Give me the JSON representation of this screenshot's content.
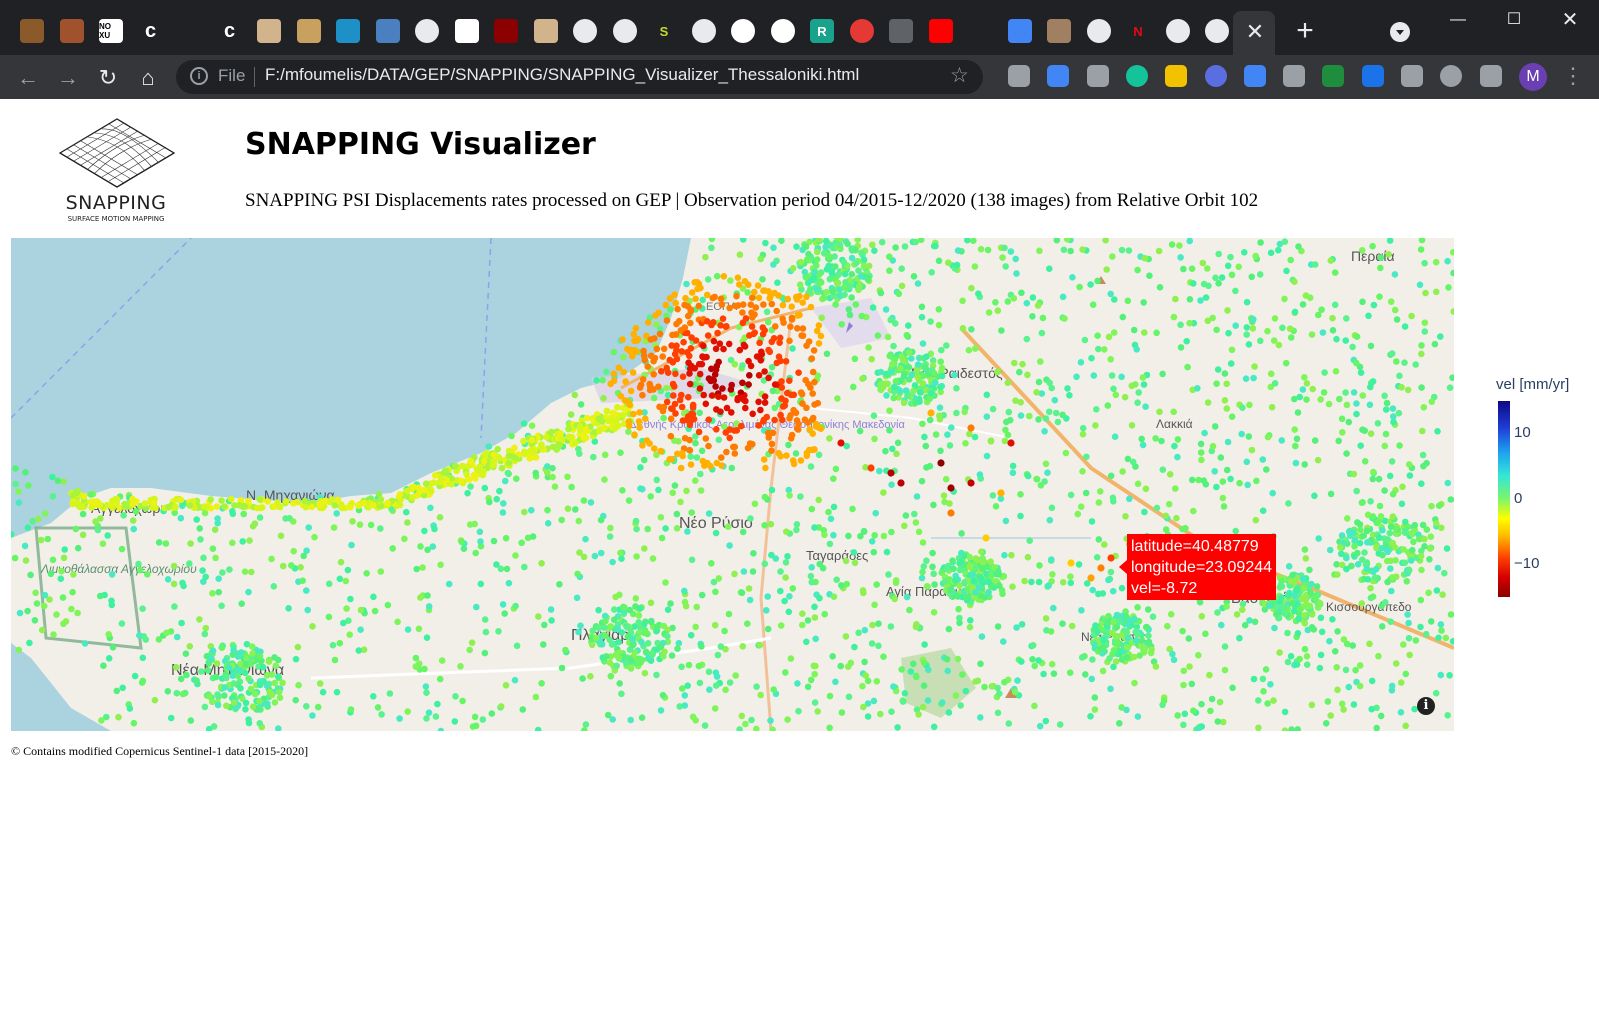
{
  "browser": {
    "tab_favicons": [
      "app-icon",
      "app-icon",
      "noxu-icon",
      "c-icon",
      "blank-icon",
      "c-icon",
      "app-icon",
      "app-icon",
      "sdesi-icon",
      "app-icon",
      "globe-icon",
      "app-icon",
      "app-icon",
      "app-icon",
      "globe-icon",
      "globe-icon",
      "s-icon",
      "chrome-icon",
      "google-icon",
      "google-icon",
      "r-icon",
      "record-icon",
      "app-icon",
      "youtube-icon",
      "link-icon",
      "translate-icon",
      "image-icon",
      "chrome-icon",
      "netflix-icon",
      "chrome-icon",
      "chrome-icon"
    ],
    "tab_letters": {
      "noxu": "NO XU",
      "c": "c",
      "s": "S",
      "r": "R",
      "netflix": "N"
    },
    "address_scheme": "File",
    "address_url": "F:/mfoumelis/DATA/GEP/SNAPPING/SNAPPING_Visualizer_Thessaloniki.html",
    "profile_initial": "M",
    "accent": "#35363a"
  },
  "page": {
    "logo_name": "SNAPPING",
    "logo_tagline": "SURFACE MOTION MAPPING",
    "title": "SNAPPING Visualizer",
    "subtitle": "SNAPPING PSI Displacements rates processed on GEP | Observation period 04/2015-12/2020 (138 images) from Relative Orbit 102",
    "copyright": "© Contains modified Copernicus Sentinel-1 data [2015-2020]"
  },
  "map": {
    "place_labels": [
      "Περαία",
      "Ν. Μηχανιώνα",
      "Αγγελοχώρι",
      "Λιμνοθάλασσα Αγγελοχωρίου",
      "Νέα Μηχανιώνα",
      "Νέα Ραιδεστός",
      "Πλαγιάρι",
      "Νέο Ρύσιο",
      "Ταγαράδες",
      "Αγία Παρασκευή",
      "Βασιλικά",
      "Κισσουργάπεδο",
      "Λακκιά",
      "Νέα Ρασσός",
      "Διεθνής Κρατικός Αερολιμένας Θεσσαλονίκης Μακεδονία",
      "ΕΟΠΑ"
    ],
    "tooltip": {
      "latitude": "latitude=40.48779",
      "longitude": "longitude=23.09244",
      "velocity": "vel=-8.72"
    },
    "colorbar": {
      "title": "vel [mm/yr]",
      "ticks": [
        "10",
        "0",
        "−10"
      ],
      "colorscale": [
        "#0d0887",
        "#1ea0f0",
        "#33e6d8",
        "#7cf56a",
        "#ffff00",
        "#ffb000",
        "#ff4000",
        "#d40000",
        "#8b0000"
      ]
    },
    "colors": {
      "sea": "#aad3df",
      "land": "#f2efe9",
      "green": "#c8dfb5"
    }
  }
}
